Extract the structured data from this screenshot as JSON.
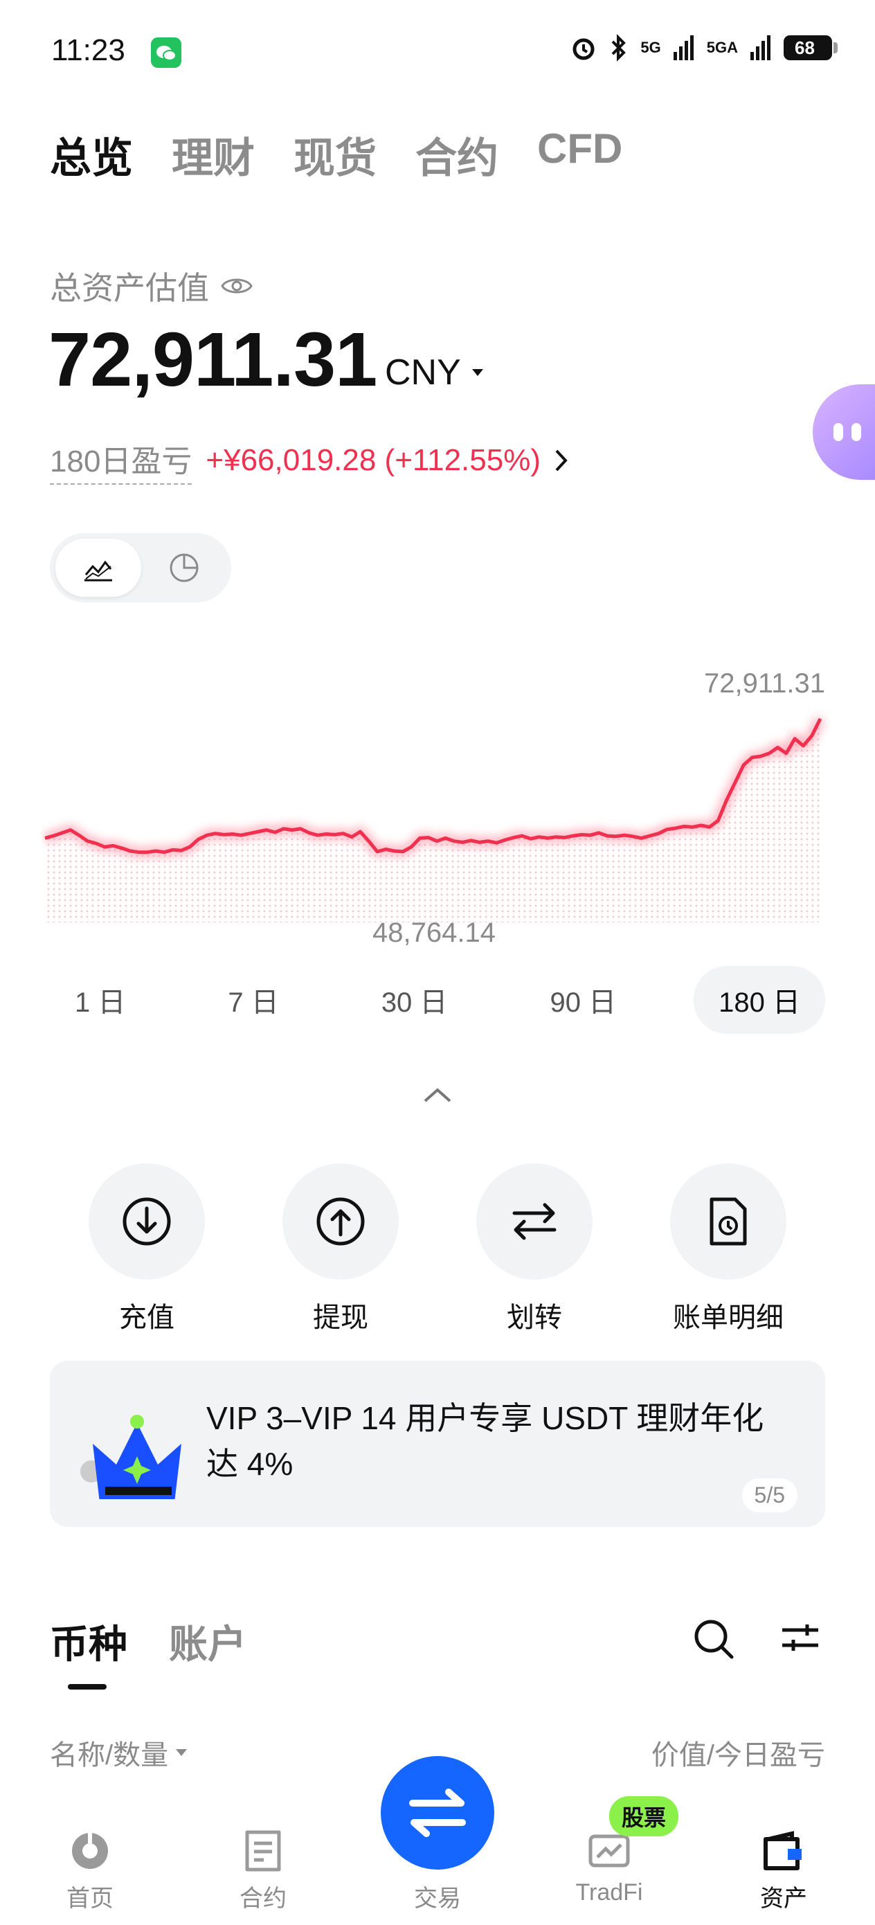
{
  "status_bar": {
    "time": "11:23",
    "net1": "5G",
    "net2": "5GA",
    "battery": "68"
  },
  "top_tabs": [
    {
      "label": "总览",
      "active": true
    },
    {
      "label": "理财",
      "active": false
    },
    {
      "label": "现货",
      "active": false
    },
    {
      "label": "合约",
      "active": false
    },
    {
      "label": "CFD",
      "active": false
    }
  ],
  "summary": {
    "label": "总资产估值",
    "value": "72,911.31",
    "currency": "CNY",
    "pnl_label": "180日盈亏",
    "pnl_value": "+¥66,019.28 (+112.55%)"
  },
  "chart_data": {
    "type": "line",
    "max_label": "72,911.31",
    "min_label": "48,764.14",
    "ylim": [
      48764.14,
      72911.31
    ],
    "values": [
      52500,
      52900,
      53400,
      53900,
      53000,
      52000,
      51600,
      51000,
      51200,
      50800,
      50300,
      50100,
      50100,
      50300,
      50100,
      50500,
      50400,
      51000,
      52300,
      53000,
      53300,
      53100,
      53200,
      53000,
      53300,
      53600,
      53900,
      53500,
      54100,
      53900,
      54100,
      53400,
      53000,
      53200,
      53100,
      53300,
      52700,
      53600,
      52000,
      50200,
      50600,
      50300,
      50200,
      51000,
      52500,
      52600,
      52000,
      52500,
      52000,
      51800,
      52100,
      51800,
      52000,
      51700,
      52200,
      52600,
      52900,
      52400,
      52700,
      52500,
      52700,
      52600,
      52900,
      53100,
      53000,
      53400,
      52900,
      52800,
      53000,
      52800,
      52500,
      52900,
      53300,
      54000,
      54200,
      54500,
      54400,
      54700,
      54400,
      55500,
      59000,
      62000,
      65000,
      66300,
      66500,
      67000,
      68000,
      67000,
      69500,
      68300,
      70000,
      72911.31
    ],
    "ranges": [
      "1 日",
      "7 日",
      "30 日",
      "90 日",
      "180 日"
    ],
    "active_range": "180 日",
    "line_color": "#f0304f"
  },
  "actions": [
    {
      "label": "充值",
      "icon": "deposit-icon"
    },
    {
      "label": "提现",
      "icon": "withdraw-icon"
    },
    {
      "label": "划转",
      "icon": "transfer-icon"
    },
    {
      "label": "账单明细",
      "icon": "bill-icon"
    }
  ],
  "banner": {
    "text": "VIP 3–VIP 14 用户专享 USDT 理财年化达 4%",
    "page": "5/5"
  },
  "list_tabs": [
    {
      "label": "币种",
      "active": true
    },
    {
      "label": "账户",
      "active": false
    }
  ],
  "list_header": {
    "left": "名称/数量",
    "right": "价值/今日盈亏"
  },
  "bottom_nav": [
    {
      "label": "首页",
      "active": false
    },
    {
      "label": "合约",
      "active": false
    },
    {
      "label": "交易",
      "active": false
    },
    {
      "label": "TradFi",
      "active": false
    },
    {
      "label": "资产",
      "active": true
    }
  ],
  "stock_badge": "股票"
}
